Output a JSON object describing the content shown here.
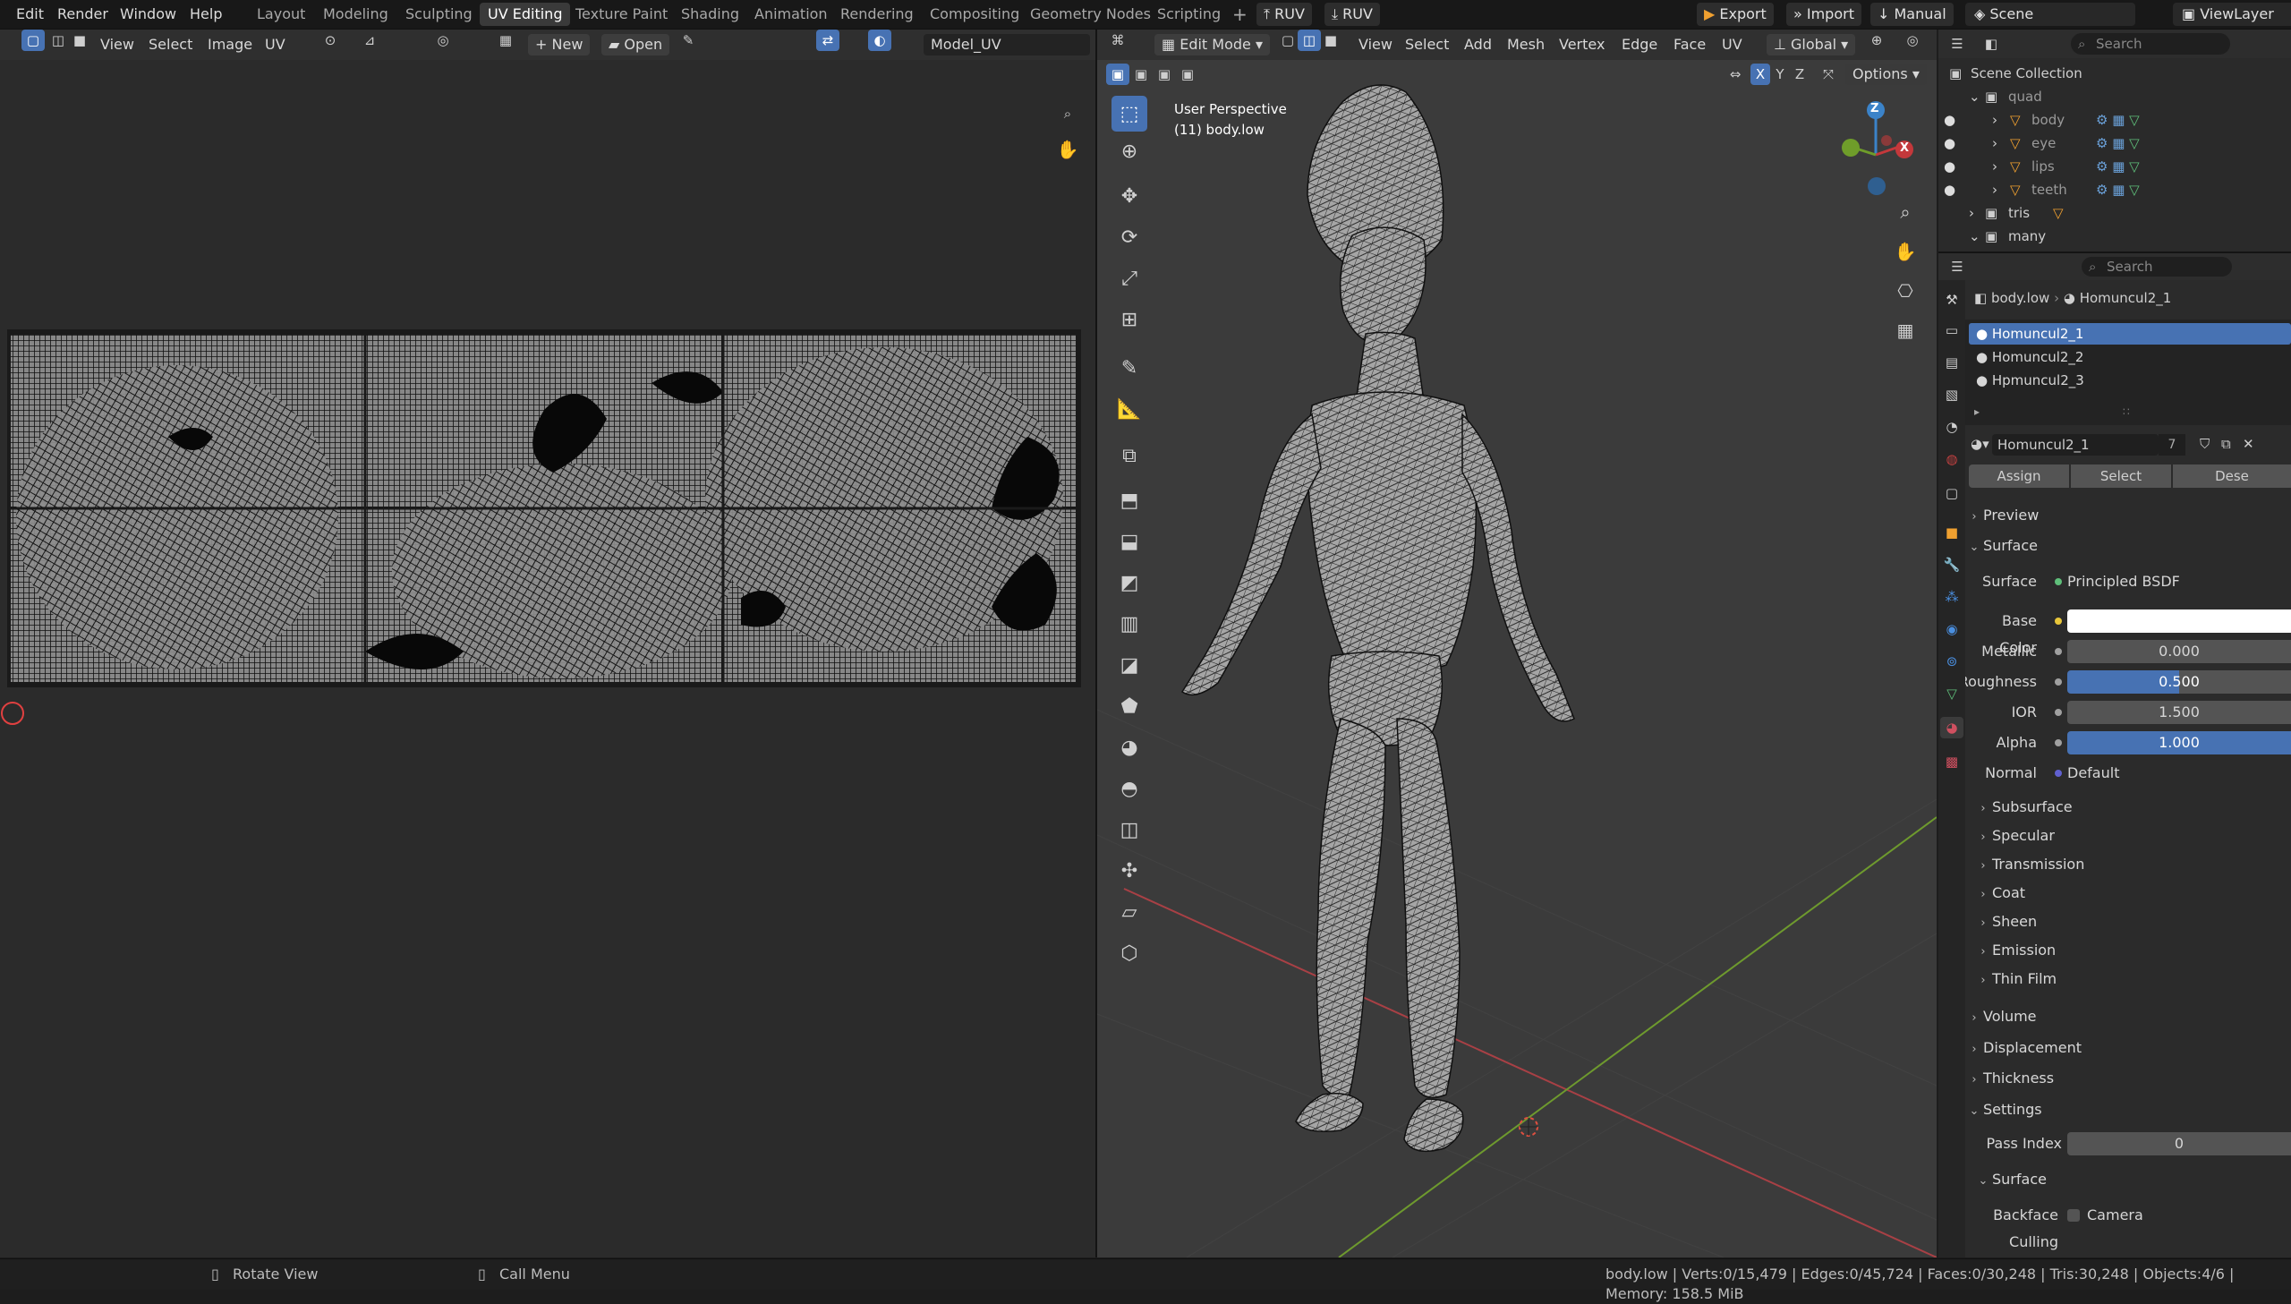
{
  "topbar": {
    "menus": [
      "Edit",
      "Render",
      "Window",
      "Help"
    ],
    "workspaces": [
      "Layout",
      "Modeling",
      "Sculpting",
      "UV Editing",
      "Texture Paint",
      "Shading",
      "Animation",
      "Rendering",
      "Compositing",
      "Geometry Nodes",
      "Scripting"
    ],
    "active_workspace": "UV Editing",
    "add_workspace": "+",
    "addon_ruv_1": "RUV",
    "addon_ruv_2": "RUV",
    "export_label": "Export",
    "import_label": "Import",
    "manual_label": "Manual",
    "scene_label": "Scene",
    "viewlayer_label": "ViewLayer"
  },
  "uv_editor": {
    "menus": [
      "View",
      "Select",
      "Image",
      "UV"
    ],
    "new_label": "New",
    "open_label": "Open",
    "image_name": "Model_UV"
  },
  "viewport": {
    "mode_label": "Edit Mode",
    "menus": [
      "View",
      "Select",
      "Add",
      "Mesh",
      "Vertex",
      "Edge",
      "Face",
      "UV"
    ],
    "orientation_label": "Global",
    "axes": [
      "X",
      "Y",
      "Z"
    ],
    "options_label": "Options",
    "overlay_title": "User Perspective",
    "overlay_object": "(11) body.low",
    "gizmo_labels": {
      "z": "Z",
      "x": "X"
    },
    "colors": {
      "x_axis": "#c4383b",
      "y_axis": "#6f9d2a",
      "z_axis": "#3b83c9"
    }
  },
  "outliner": {
    "search_placeholder": "Search",
    "root": "Scene Collection",
    "items": [
      {
        "name": "quad",
        "kind": "collection"
      },
      {
        "name": "body",
        "kind": "mesh"
      },
      {
        "name": "eye",
        "kind": "mesh"
      },
      {
        "name": "lips",
        "kind": "mesh"
      },
      {
        "name": "teeth",
        "kind": "mesh"
      },
      {
        "name": "tris",
        "kind": "collection"
      },
      {
        "name": "many",
        "kind": "collection"
      }
    ]
  },
  "properties": {
    "search_placeholder": "Search",
    "breadcrumb_object": "body.low",
    "breadcrumb_material": "Homuncul2_1",
    "material_slots": [
      "Homuncul2_1",
      "Homuncul2_2",
      "Hpmuncul2_3"
    ],
    "active_slot": "Homuncul2_1",
    "material_name": "Homuncul2_1",
    "material_users": "7",
    "assign_label": "Assign",
    "select_label": "Select",
    "deselect_label": "Dese",
    "sections": {
      "preview": "Preview",
      "surface": "Surface",
      "subsurface": "Subsurface",
      "specular": "Specular",
      "transmission": "Transmission",
      "coat": "Coat",
      "sheen": "Sheen",
      "emission": "Emission",
      "thin_film": "Thin Film",
      "volume": "Volume",
      "displacement": "Displacement",
      "thickness": "Thickness",
      "settings": "Settings",
      "settings_surface": "Surface"
    },
    "surface_label": "Surface",
    "surface_value": "Principled BSDF",
    "base_color_label": "Base Color",
    "metallic_label": "Metallic",
    "metallic_value": "0.000",
    "roughness_label": "Roughness",
    "roughness_value": "0.500",
    "ior_label": "IOR",
    "ior_value": "1.500",
    "alpha_label": "Alpha",
    "alpha_value": "1.000",
    "normal_label": "Normal",
    "normal_value": "Default",
    "pass_index_label": "Pass Index",
    "pass_index_value": "0",
    "backface_label": "Backface Culling",
    "camera_label": "Camera",
    "colors": {
      "base_color": "#ffffff",
      "accent": "#4772b3"
    }
  },
  "statusbar": {
    "rotate_view": "Rotate View",
    "call_menu": "Call Menu",
    "stats": "body.low | Verts:0/15,479 | Edges:0/45,724 | Faces:0/30,248 | Tris:30,248 | Objects:4/6 | Memory: 158.5 MiB"
  }
}
